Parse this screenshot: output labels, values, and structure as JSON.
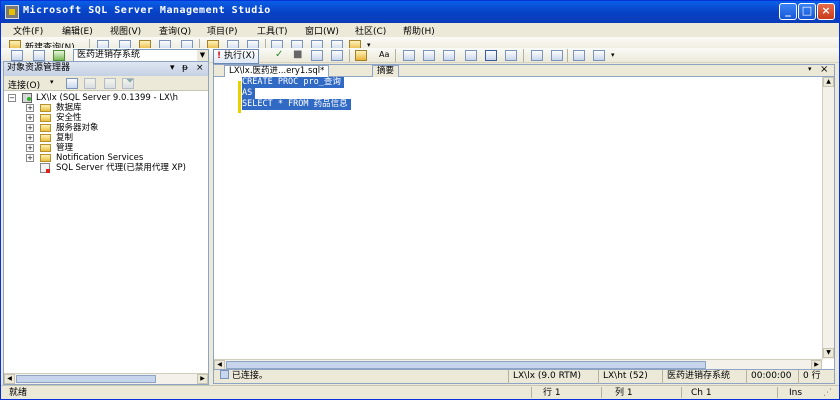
{
  "window": {
    "title": "Microsoft SQL Server Management Studio"
  },
  "menu": [
    "文件(F)",
    "编辑(E)",
    "视图(V)",
    "查询(Q)",
    "项目(P)",
    "工具(T)",
    "窗口(W)",
    "社区(C)",
    "帮助(H)"
  ],
  "toolbar1": {
    "new_query": "新建查询(N)"
  },
  "toolbar2": {
    "database": "医药进销存系统",
    "execute": "执行(X)"
  },
  "object_explorer": {
    "title": "对象资源管理器",
    "connect": "连接(O)",
    "root": "LX\\lx (SQL Server 9.0.1399 - LX\\h",
    "children": [
      "数据库",
      "安全性",
      "服务器对象",
      "复制",
      "管理",
      "Notification Services"
    ],
    "agent": "SQL Server 代理(已禁用代理 XP)"
  },
  "editor": {
    "tabs": [
      "LX\\lx.医药进...ery1.sql*",
      "摘要"
    ],
    "lines": [
      "CREATE PROC pro_查询",
      "AS",
      "SELECT * FROM 药品信息"
    ]
  },
  "query_status": {
    "connected": "已连接。",
    "server": "LX\\lx (9.0 RTM)",
    "user": "LX\\ht (52)",
    "database": "医药进销存系统",
    "time": "00:00:00",
    "rows": "0 行"
  },
  "status_bar": {
    "ready": "就绪",
    "line": "行 1",
    "col": "列 1",
    "ch": "Ch 1",
    "mode": "Ins"
  }
}
